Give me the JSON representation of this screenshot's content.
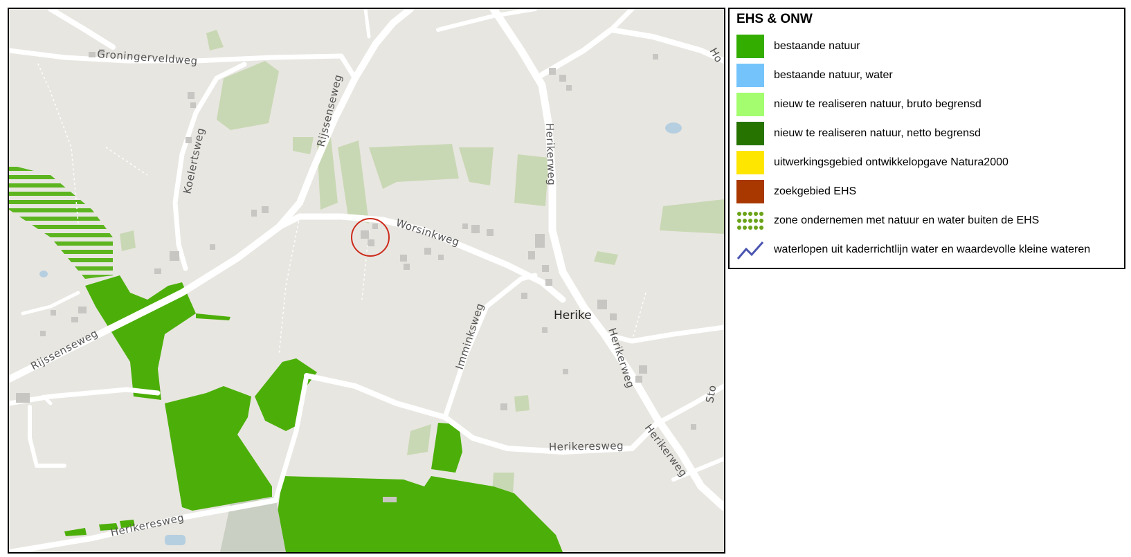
{
  "map": {
    "road_labels": {
      "groningerveldweg": "Groningerveldweg",
      "rijssenseweg_north": "Rijssenseweg",
      "rijssenseweg_west": "Rijssenseweg",
      "koelertsweg": "Koelertsweg",
      "worsinkweg": "Worsinkweg",
      "herikerweg_north": "Herikerweg",
      "herikerweg_mid": "Herikerweg",
      "herikerweg_south": "Herikerweg",
      "imminksweg": "Imminksweg",
      "herikeresweg_east": "Herikeresweg",
      "herikeresweg_south": "Herikeresweg",
      "edge_ho": "Ho",
      "edge_sto": "Sto"
    },
    "place_labels": {
      "herike": "Herike"
    },
    "colors": {
      "background": "#e8e6e1",
      "road": "#ffffff",
      "nature": "#4caf09",
      "light_nature": "#c9d8b4",
      "building": "#c8c6c2",
      "water": "#b6cfe0",
      "marker": "#cc2a1a"
    }
  },
  "legend": {
    "title": "EHS & ONW",
    "items": [
      {
        "label": "bestaande natuur",
        "color": "#33ad00",
        "swatch": "solid",
        "name": "bestaande-natuur"
      },
      {
        "label": "bestaande natuur, water",
        "color": "#74c4fb",
        "swatch": "solid",
        "name": "bestaande-natuur-water"
      },
      {
        "label": "nieuw te realiseren natuur, bruto begrensd",
        "color": "#a3fd6e",
        "swatch": "solid",
        "name": "nieuw-bruto"
      },
      {
        "label": "nieuw te realiseren natuur, netto begrensd",
        "color": "#267300",
        "swatch": "solid",
        "name": "nieuw-netto"
      },
      {
        "label": "uitwerkingsgebied ontwikkelopgave Natura2000",
        "color": "#ffe600",
        "swatch": "solid",
        "name": "natura2000"
      },
      {
        "label": "zoekgebied EHS",
        "color": "#a93800",
        "swatch": "solid",
        "name": "zoekgebied-ehs"
      },
      {
        "label": "zone ondernemen met natuur en water buiten de EHS",
        "color": "#6ba318",
        "swatch": "dots",
        "name": "zone-ondernemen"
      },
      {
        "label": "waterlopen uit kaderrichtlijn water en waardevolle kleine wateren",
        "color": "#4a54b0",
        "swatch": "line",
        "name": "waterlopen"
      }
    ]
  }
}
